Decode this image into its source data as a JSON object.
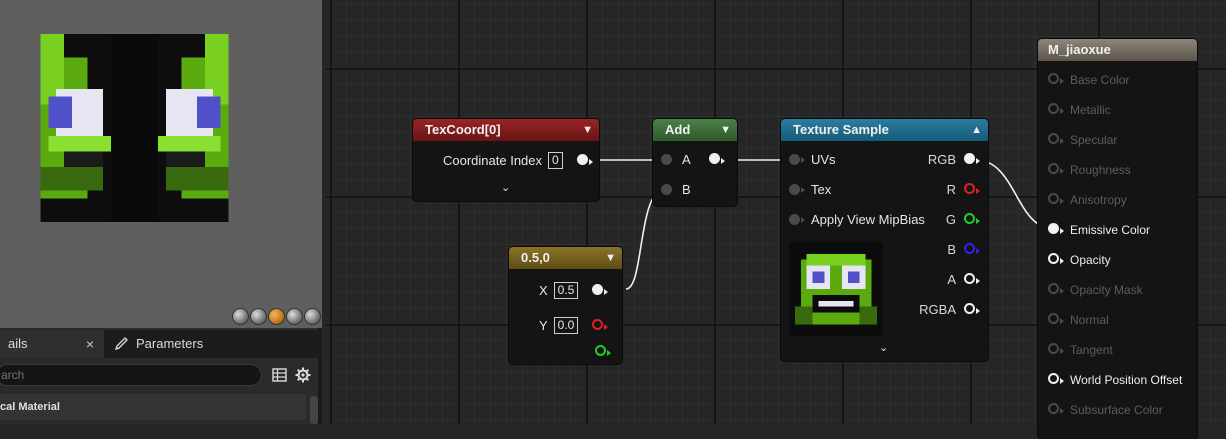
{
  "preview": {
    "shape_buttons": [
      "cylinder",
      "sphere",
      "plane",
      "cube",
      "custom-mesh"
    ]
  },
  "details": {
    "tabs": [
      {
        "label": "ails",
        "close": "×"
      },
      {
        "label": "Parameters"
      }
    ],
    "search_placeholder": "arch",
    "section_title": "cal Material"
  },
  "nodes": {
    "texcoord": {
      "title": "TexCoord[0]",
      "pin_label": "Coordinate Index",
      "value": "0",
      "header_color": "#8a1e1e"
    },
    "add": {
      "title": "Add",
      "pin_a": "A",
      "pin_b": "B",
      "header_color": "#3e6b3a"
    },
    "const": {
      "title": "0.5,0",
      "x_label": "X",
      "x_value": "0.5",
      "y_label": "Y",
      "y_value": "0.0",
      "header_color": "#7a6422"
    },
    "texsample": {
      "title": "Texture Sample",
      "inputs": [
        "UVs",
        "Tex",
        "Apply View MipBias"
      ],
      "outputs": [
        "RGB",
        "R",
        "G",
        "B",
        "A",
        "RGBA"
      ],
      "header_color": "#1e6a8a"
    },
    "material": {
      "title": "M_jiaoxue",
      "pins": [
        {
          "label": "Base Color",
          "state": "dim"
        },
        {
          "label": "Metallic",
          "state": "dim"
        },
        {
          "label": "Specular",
          "state": "dim"
        },
        {
          "label": "Roughness",
          "state": "dim"
        },
        {
          "label": "Anisotropy",
          "state": "dim"
        },
        {
          "label": "Emissive Color",
          "state": "connected"
        },
        {
          "label": "Opacity",
          "state": "active"
        },
        {
          "label": "Opacity Mask",
          "state": "dim"
        },
        {
          "label": "Normal",
          "state": "dim"
        },
        {
          "label": "Tangent",
          "state": "dim"
        },
        {
          "label": "World Position Offset",
          "state": "active"
        },
        {
          "label": "Subsurface Color",
          "state": "dim"
        }
      ]
    }
  }
}
